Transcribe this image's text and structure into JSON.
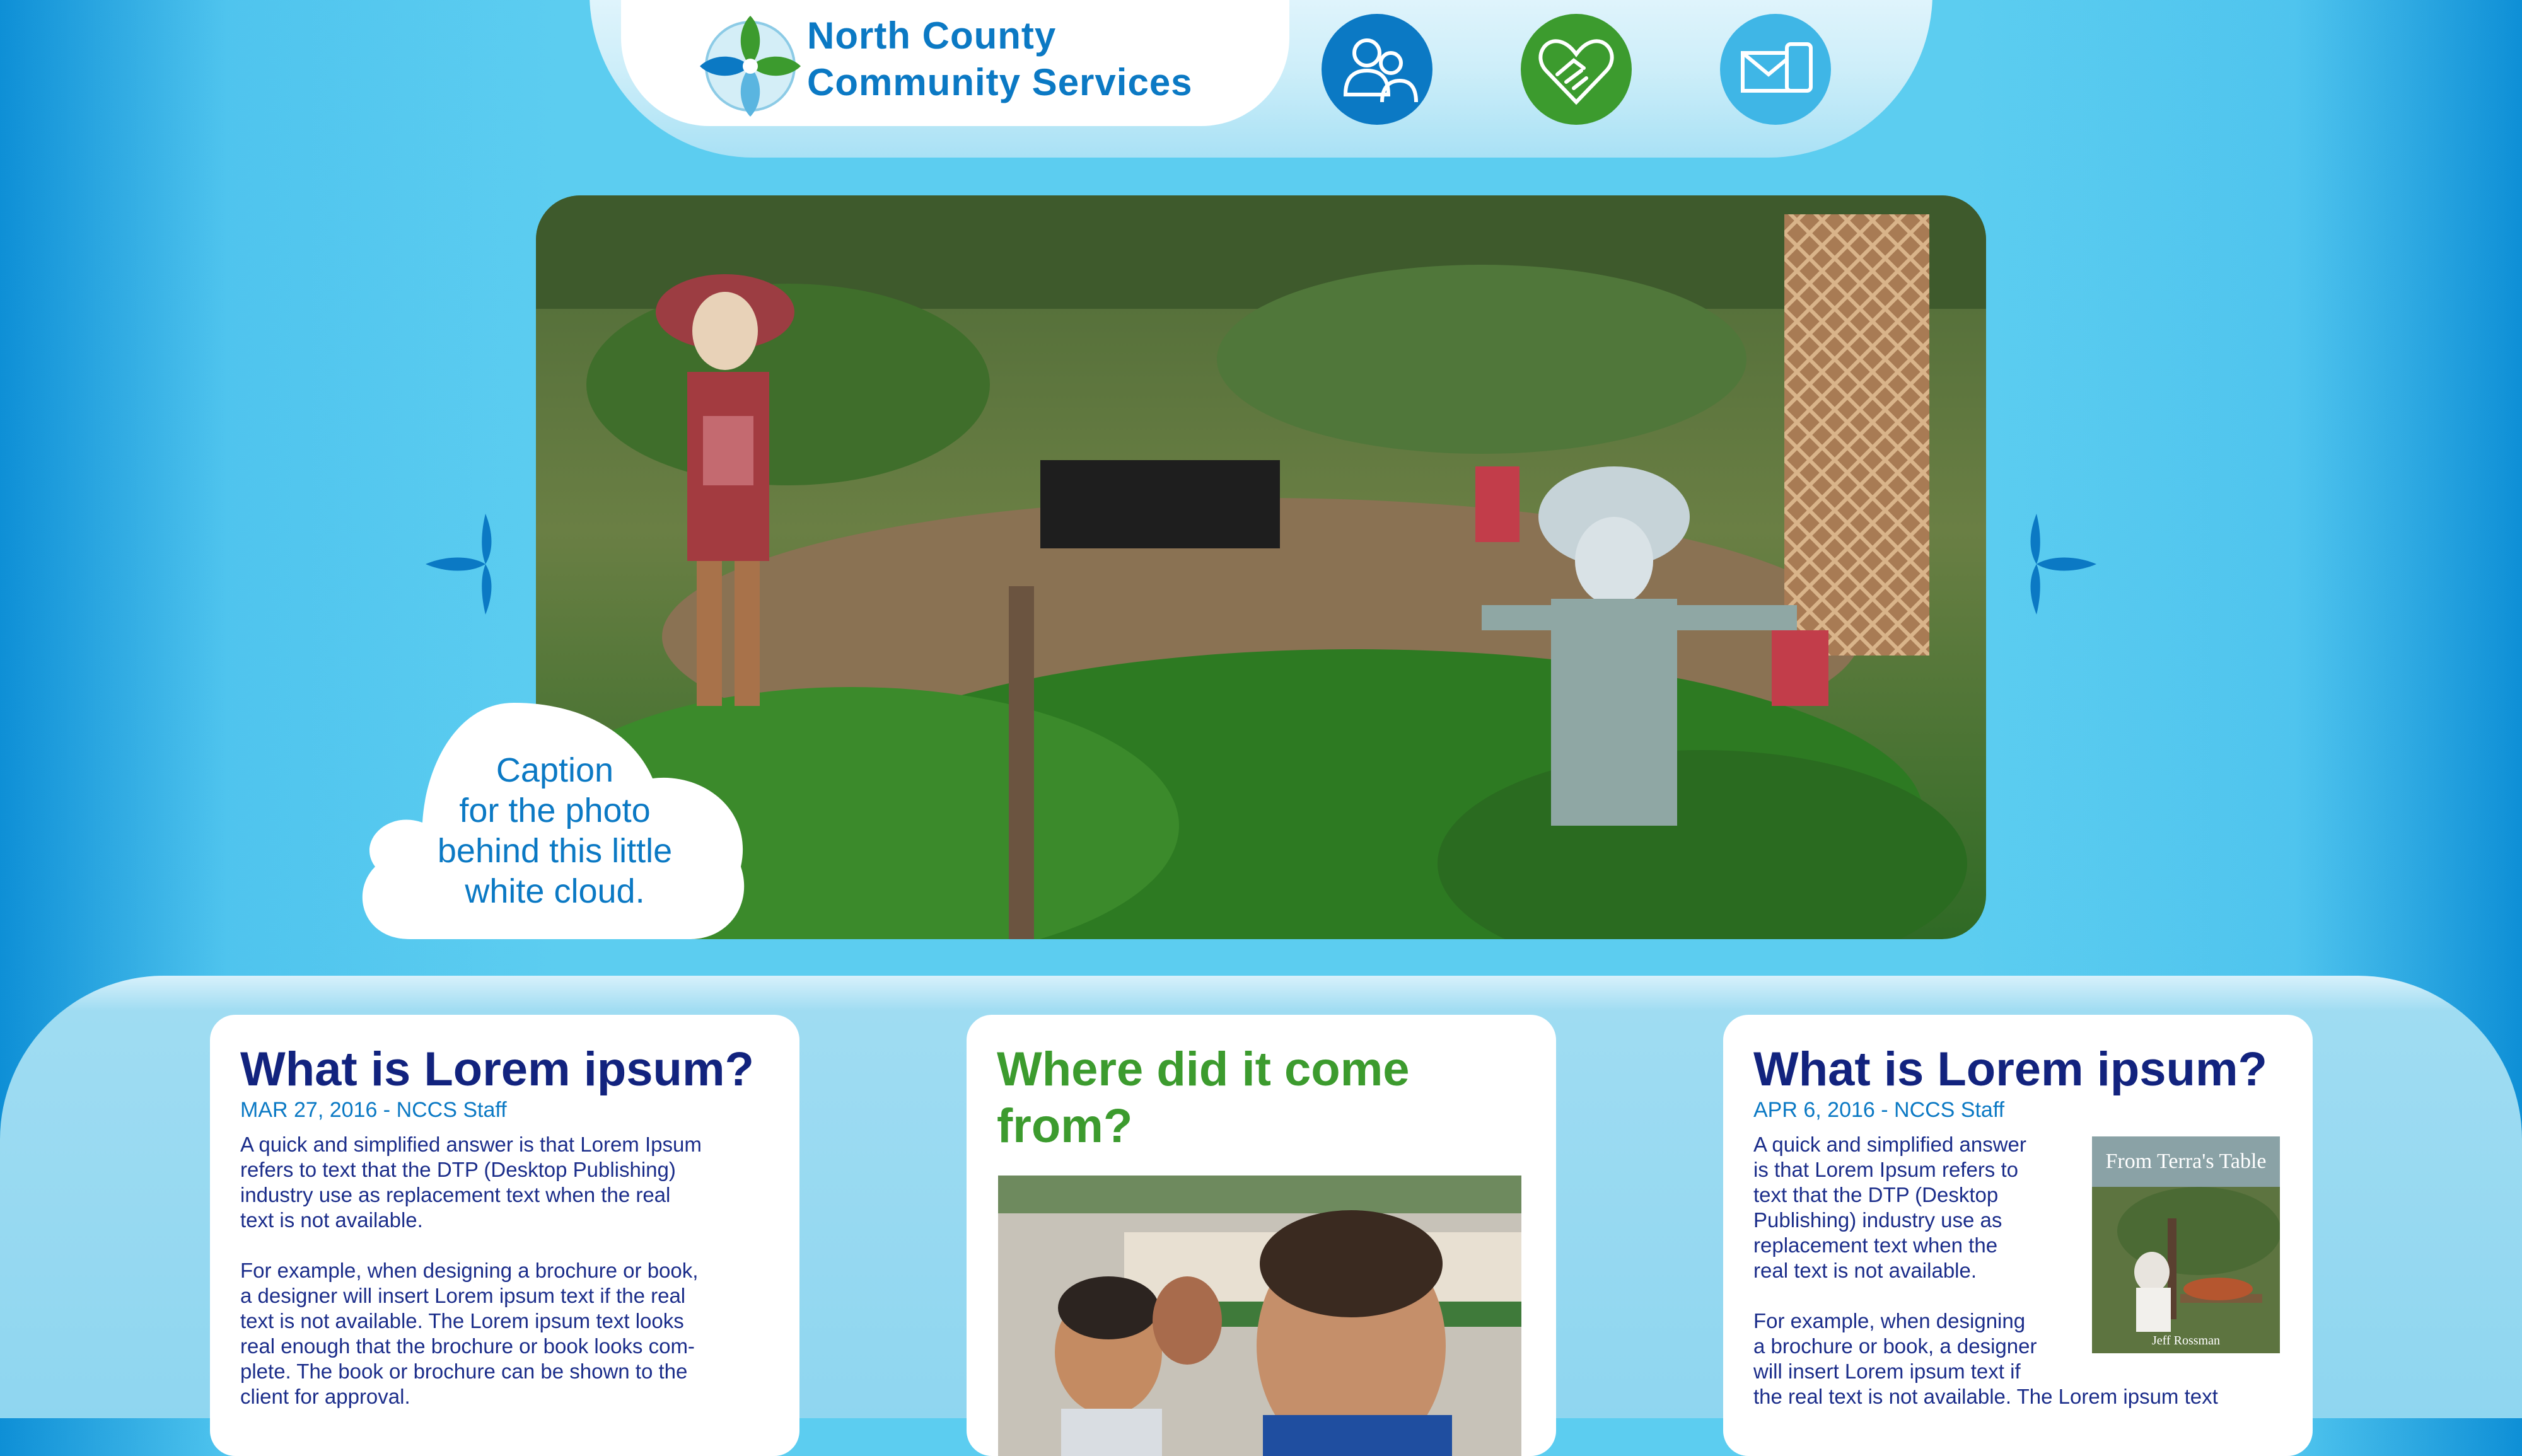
{
  "header": {
    "org_name_line1": "North County",
    "org_name_line2": "Community Services",
    "icons": [
      "people-icon",
      "handshake-heart-icon",
      "mail-device-icon"
    ],
    "colors": {
      "brand_blue": "#0b79c4",
      "brand_green": "#3c9b2e",
      "navy": "#12237e"
    }
  },
  "hero": {
    "caption_lines": [
      "Caption",
      "for the photo",
      "behind this little",
      "white cloud."
    ]
  },
  "cards": [
    {
      "title": "What is Lorem ipsum?",
      "meta": "MAR 27, 2016 - NCCS Staff",
      "body_lines": [
        "A quick and simplified answer is that Lorem Ipsum",
        "refers to text that the DTP (Desktop Publishing)",
        "industry use as replacement text when the real",
        "text is not available.",
        "",
        "For example, when designing a brochure or book,",
        "a designer will insert Lorem ipsum text if the real",
        "text is not available. The Lorem ipsum text looks",
        "real enough that the brochure or book looks com-",
        "plete. The book or brochure can be shown to the",
        "client for approval."
      ]
    },
    {
      "title_line1": "Where did it come",
      "title_line2": "from?"
    },
    {
      "title": "What is Lorem ipsum?",
      "meta": "APR 6, 2016 - NCCS Staff",
      "body_lines": [
        "A quick and simplified answer",
        "is that Lorem Ipsum refers to",
        "text that the DTP (Desktop",
        "Publishing) industry use as",
        "replacement text when the",
        "real text is not available.",
        "",
        "For example, when designing",
        "a brochure or book, a designer",
        "will insert Lorem ipsum text if",
        "the real text is not available. The Lorem ipsum text"
      ],
      "book": {
        "title": "From Terra's Table",
        "author": "Jeff Rossman"
      }
    }
  ]
}
